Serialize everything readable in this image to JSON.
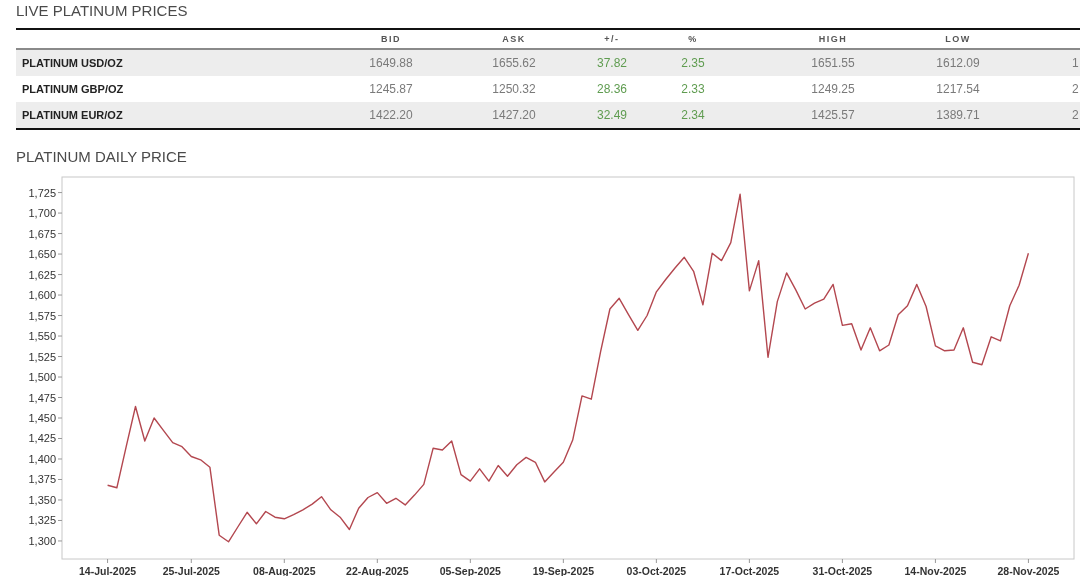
{
  "live_prices": {
    "title": "LIVE PLATINUM PRICES",
    "table": {
      "columns": [
        "BID",
        "ASK",
        "+/-",
        "%",
        "HIGH",
        "LOW"
      ],
      "rows": [
        {
          "name": "PLATINUM USD/OZ",
          "bid": "1649.88",
          "ask": "1655.62",
          "change": "37.82",
          "percent": "2.35",
          "high": "1651.55",
          "low": "1612.09",
          "column_7": "1"
        },
        {
          "name": "PLATINUM GBP/OZ",
          "bid": "1245.87",
          "ask": "1250.32",
          "change": "28.36",
          "percent": "2.33",
          "high": "1249.25",
          "low": "1217.54",
          "column_7": "2"
        },
        {
          "name": "PLATINUM EUR/OZ",
          "bid": "1422.20",
          "ask": "1427.20",
          "change": "32.49",
          "percent": "2.34",
          "high": "1425.57",
          "low": "1389.71",
          "column_7": "2"
        }
      ]
    }
  },
  "chart": {
    "title": "PLATINUM DAILY PRICE",
    "chart_data": {
      "type": "line",
      "categories": [
        "14-Jul-2025",
        null,
        null,
        null,
        null,
        null,
        null,
        null,
        null,
        "25-Jul-2025",
        null,
        null,
        null,
        null,
        null,
        null,
        null,
        null,
        null,
        "08-Aug-2025",
        null,
        null,
        null,
        null,
        null,
        null,
        null,
        null,
        null,
        "22-Aug-2025",
        null,
        null,
        null,
        null,
        null,
        null,
        null,
        null,
        null,
        "05-Sep-2025",
        null,
        null,
        null,
        null,
        null,
        null,
        null,
        null,
        null,
        "19-Sep-2025",
        null,
        null,
        null,
        null,
        null,
        null,
        null,
        null,
        null,
        "03-Oct-2025",
        null,
        null,
        null,
        null,
        null,
        null,
        null,
        null,
        null,
        "17-Oct-2025",
        null,
        null,
        null,
        null,
        null,
        null,
        null,
        null,
        null,
        "31-Oct-2025",
        null,
        null,
        null,
        null,
        null,
        null,
        null,
        null,
        null,
        "14-Nov-2025",
        null,
        null,
        null,
        null,
        null,
        null,
        null,
        null,
        null,
        "28-Nov-2025"
      ],
      "values": [
        1368,
        1365,
        1415,
        1464,
        1422,
        1450,
        1435,
        1420,
        1415,
        1403,
        1399,
        1390,
        1307,
        1299,
        1317,
        1335,
        1321,
        1336,
        1329,
        1327,
        1332,
        1338,
        1345,
        1354,
        1338,
        1329,
        1314,
        1340,
        1353,
        1359,
        1346,
        1352,
        1344,
        1356,
        1369,
        1413,
        1411,
        1422,
        1381,
        1373,
        1388,
        1373,
        1392,
        1379,
        1393,
        1402,
        1396,
        1372,
        1384,
        1396,
        1423,
        1477,
        1473,
        1531,
        1583,
        1596,
        1576,
        1557,
        1575,
        1604,
        1619,
        1633,
        1646,
        1629,
        1588,
        1651,
        1642,
        1664,
        1723,
        1605,
        1642,
        1524,
        1592,
        1627,
        1606,
        1583,
        1590,
        1595,
        1613,
        1563,
        1565,
        1533,
        1560,
        1532,
        1539,
        1576,
        1587,
        1613,
        1586,
        1538,
        1532,
        1533,
        1560,
        1518,
        1515,
        1549,
        1544,
        1587,
        1612,
        1651
      ],
      "ylim": [
        1278,
        1744
      ],
      "yticks": [
        {
          "value": 1300,
          "label": "1,300"
        },
        {
          "value": 1325,
          "label": "1,325"
        },
        {
          "value": 1350,
          "label": "1,350"
        },
        {
          "value": 1375,
          "label": "1,375"
        },
        {
          "value": 1400,
          "label": "1,400"
        },
        {
          "value": 1425,
          "label": "1,425"
        },
        {
          "value": 1450,
          "label": "1,450"
        },
        {
          "value": 1475,
          "label": "1,475"
        },
        {
          "value": 1500,
          "label": "1,500"
        },
        {
          "value": 1525,
          "label": "1,525"
        },
        {
          "value": 1550,
          "label": "1,550"
        },
        {
          "value": 1575,
          "label": "1,575"
        },
        {
          "value": 1600,
          "label": "1,600"
        },
        {
          "value": 1625,
          "label": "1,625"
        },
        {
          "value": 1650,
          "label": "1,650"
        },
        {
          "value": 1675,
          "label": "1,675"
        },
        {
          "value": 1700,
          "label": "1,700"
        },
        {
          "value": 1725,
          "label": "1,725"
        }
      ]
    }
  }
}
